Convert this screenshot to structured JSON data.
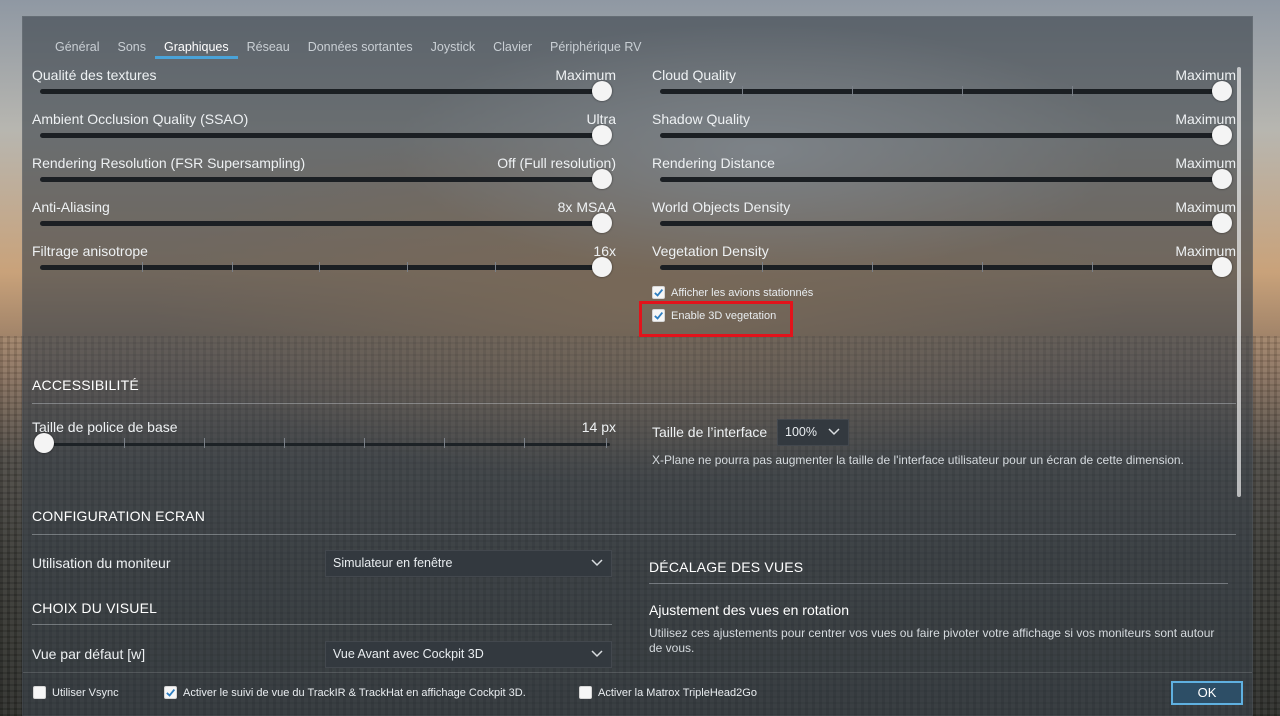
{
  "tabs": [
    {
      "label": "Général",
      "active": false
    },
    {
      "label": "Sons",
      "active": false
    },
    {
      "label": "Graphiques",
      "active": true
    },
    {
      "label": "Réseau",
      "active": false
    },
    {
      "label": "Données sortantes",
      "active": false
    },
    {
      "label": "Joystick",
      "active": false
    },
    {
      "label": "Clavier",
      "active": false
    },
    {
      "label": "Périphérique  RV",
      "active": false
    }
  ],
  "left_sliders": [
    {
      "label": "Qualité des textures",
      "value": "Maximum",
      "level": 1.0
    },
    {
      "label": "Ambient Occlusion Quality (SSAO)",
      "value": "Ultra",
      "level": 1.0
    },
    {
      "label": "Rendering Resolution (FSR Supersampling)",
      "value": "Off (Full resolution)",
      "level": 1.0
    },
    {
      "label": "Anti-Aliasing",
      "value": "8x MSAA",
      "level": 1.0
    },
    {
      "label": "Filtrage anisotrope",
      "value": "16x",
      "level": 1.0
    }
  ],
  "right_sliders": [
    {
      "label": "Cloud Quality",
      "value": "Maximum",
      "level": 1.0
    },
    {
      "label": "Shadow Quality",
      "value": "Maximum",
      "level": 1.0
    },
    {
      "label": "Rendering Distance",
      "value": "Maximum",
      "level": 1.0
    },
    {
      "label": "World Objects Density",
      "value": "Maximum",
      "level": 1.0
    },
    {
      "label": "Vegetation Density",
      "value": "Maximum",
      "level": 1.0
    }
  ],
  "checkboxes": {
    "parked_aircraft": {
      "label": "Afficher les avions stationnés",
      "checked": true
    },
    "vegetation_3d": {
      "label": "Enable 3D vegetation",
      "checked": true
    }
  },
  "accessibility": {
    "heading": "ACCESSIBILITÉ",
    "font_size_label": "Taille de police de base",
    "font_size_value": "14 px",
    "font_size_level": 0.0,
    "ui_size_label": "Taille de l’interface",
    "ui_size_value": "100%",
    "ui_size_note": "X-Plane ne pourra pas augmenter la taille de l'interface utilisateur pour un écran de cette dimension."
  },
  "screen_config": {
    "heading": "CONFIGURATION ECRAN",
    "monitor_label": "Utilisation du moniteur",
    "monitor_value": "Simulateur en fenêtre"
  },
  "visual_choice": {
    "heading": "CHOIX DU VISUEL",
    "default_view_label": "Vue par défaut [w]",
    "default_view_value": "Vue Avant avec Cockpit 3D"
  },
  "view_offset": {
    "heading": "DÉCALAGE DES VUES",
    "subheading": "Ajustement des vues en rotation",
    "description": "Utilisez ces ajustements pour centrer vos vues ou faire pivoter votre affichage si vos moniteurs sont autour de vous."
  },
  "footer": {
    "vsync": {
      "label": "Utiliser Vsync",
      "checked": false
    },
    "trackir": {
      "label": "Activer le suivi de vue du TrackIR & TrackHat en affichage Cockpit 3D.",
      "checked": true
    },
    "matrox": {
      "label": "Activer la Matrox TripleHead2Go",
      "checked": false
    },
    "ok_label": "OK"
  },
  "colors": {
    "accent": "#4aa3d8",
    "highlight_border": "#e2131b",
    "panel": "#3a424a"
  }
}
